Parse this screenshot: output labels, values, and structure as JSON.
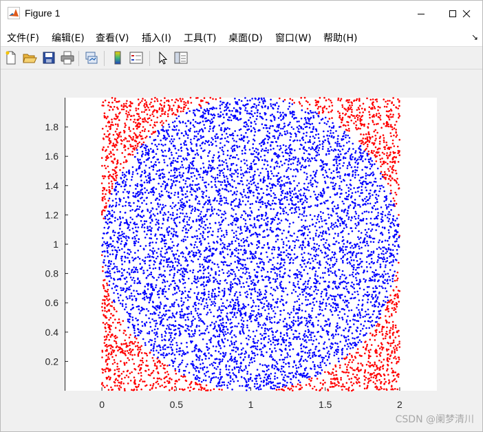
{
  "window": {
    "title": "Figure 1",
    "controls": [
      "minimize",
      "maximize",
      "close"
    ]
  },
  "menu": {
    "items": [
      "文件(F)",
      "编辑(E)",
      "查看(V)",
      "插入(I)",
      "工具(T)",
      "桌面(D)",
      "窗口(W)",
      "帮助(H)"
    ],
    "dock_icon": "dock-arrow-icon"
  },
  "toolbar": {
    "buttons": [
      {
        "name": "new-figure",
        "icon": "new-document-icon"
      },
      {
        "name": "open-file",
        "icon": "folder-open-icon"
      },
      {
        "name": "save-figure",
        "icon": "save-disk-icon"
      },
      {
        "name": "print-figure",
        "icon": "printer-icon"
      },
      {
        "name": "link-plot",
        "icon": "link-plot-icon"
      },
      {
        "name": "insert-colorbar",
        "icon": "colorbar-icon"
      },
      {
        "name": "insert-legend",
        "icon": "legend-icon"
      },
      {
        "name": "edit-plot",
        "icon": "pointer-arrow-icon"
      },
      {
        "name": "property-inspector",
        "icon": "property-inspector-icon"
      }
    ]
  },
  "chart_data": {
    "type": "scatter",
    "title": "",
    "xlabel": "",
    "ylabel": "",
    "xlim": [
      -0.25,
      2.25
    ],
    "ylim": [
      0,
      2
    ],
    "xticks": [
      0,
      0.5,
      1,
      1.5,
      2
    ],
    "xtick_labels": [
      "0",
      "0.5",
      "1",
      "1.5",
      "2"
    ],
    "yticks": [
      0.2,
      0.4,
      0.6,
      0.8,
      1,
      1.2,
      1.4,
      1.6,
      1.8
    ],
    "ytick_labels": [
      "0.2",
      "0.4",
      "0.6",
      "0.8",
      "1",
      "1.2",
      "1.4",
      "1.6",
      "1.8"
    ],
    "sample_region": {
      "x": [
        0,
        2
      ],
      "y": [
        0,
        2
      ]
    },
    "circle": {
      "center": [
        1,
        1
      ],
      "radius": 1
    },
    "series": [
      {
        "point_set": "inside circle",
        "color": "#0000ff"
      },
      {
        "point_set": "outside circle",
        "color": "#ff0000"
      }
    ],
    "approx_point_count": 10000,
    "grid": false,
    "legend": "none"
  },
  "watermark": "CSDN @阑梦清川"
}
